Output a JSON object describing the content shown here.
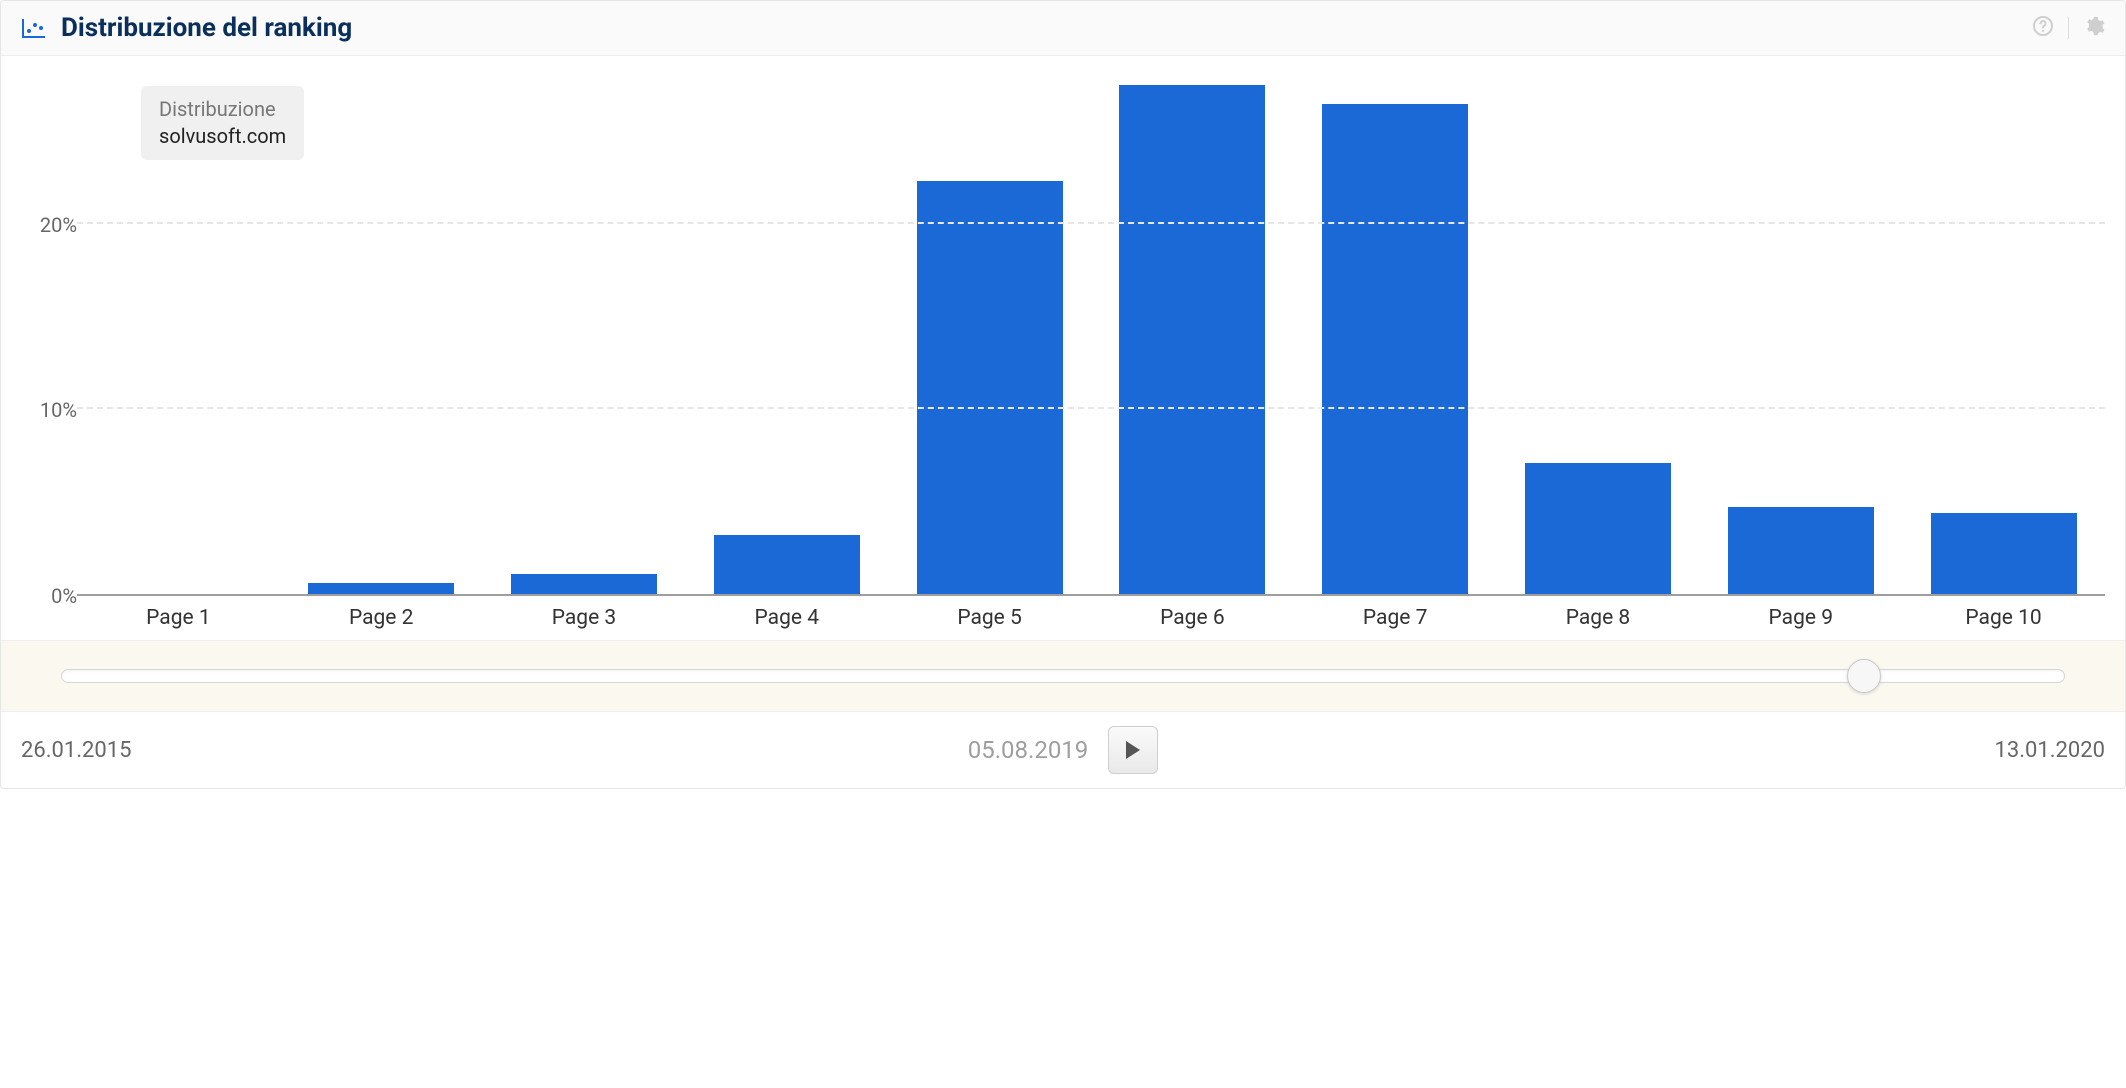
{
  "header": {
    "title": "Distribuzione del ranking"
  },
  "legend": {
    "title": "Distribuzione",
    "domain": "solvusoft.com"
  },
  "timeline": {
    "start_date": "26.01.2015",
    "current_date": "05.08.2019",
    "end_date": "13.01.2020",
    "thumb_pos_pct": 90
  },
  "chart_data": {
    "type": "bar",
    "title": "Distribuzione del ranking",
    "xlabel": "",
    "ylabel": "",
    "categories": [
      "Page 1",
      "Page 2",
      "Page 3",
      "Page 4",
      "Page 5",
      "Page 6",
      "Page 7",
      "Page 8",
      "Page 9",
      "Page 10"
    ],
    "values": [
      0,
      0.6,
      1.1,
      3.2,
      22.3,
      27.5,
      26.5,
      7.1,
      4.7,
      4.4
    ],
    "ylim": [
      0,
      28
    ],
    "y_ticks": [
      0,
      10,
      20
    ],
    "y_tick_labels": [
      "0%",
      "10%",
      "20%"
    ],
    "series_name": "solvusoft.com",
    "unit": "%"
  }
}
